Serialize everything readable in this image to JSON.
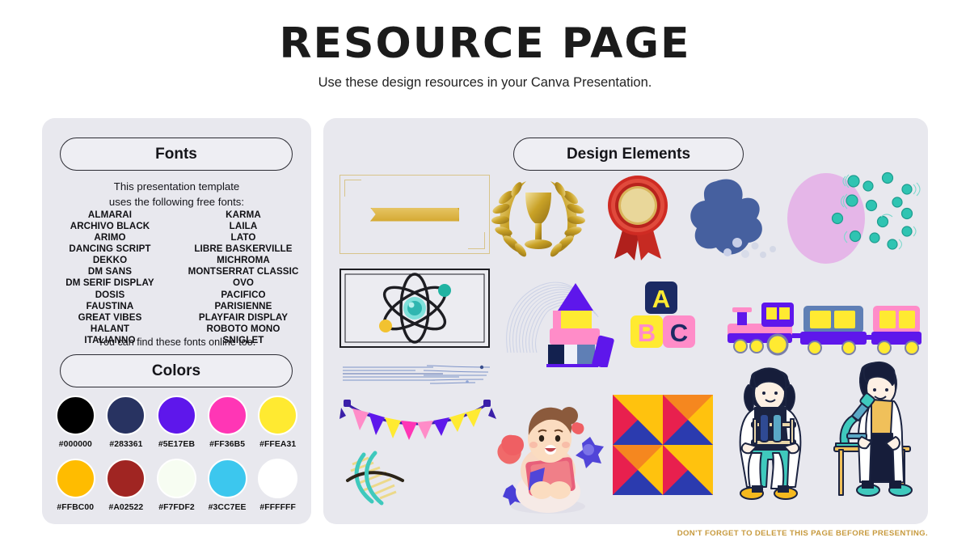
{
  "header": {
    "title": "RESOURCE PAGE",
    "subtitle": "Use these design resources in your Canva Presentation."
  },
  "fonts_panel": {
    "pill_label": "Fonts",
    "intro_line1": "This presentation template",
    "intro_line2": "uses the following free fonts:",
    "column_left": [
      "ALMARAI",
      "ARCHIVO BLACK",
      "ARIMO",
      "DANCING SCRIPT",
      "DEKKO",
      "DM SANS",
      "DM SERIF DISPLAY",
      "DOSIS",
      "FAUSTINA",
      "GREAT VIBES",
      "HALANT",
      "ITALIANNO"
    ],
    "column_right": [
      "KARMA",
      "LAILA",
      "LATO",
      "LIBRE BASKERVILLE",
      "MICHROMA",
      "MONTSERRAT CLASSIC",
      "OVO",
      "PACIFICO",
      "PARISIENNE",
      "PLAYFAIR DISPLAY",
      "ROBOTO MONO",
      "SNIGLET"
    ],
    "outro": "You can find these fonts online too."
  },
  "colors_panel": {
    "pill_label": "Colors",
    "swatches": [
      {
        "hex": "#000000",
        "label": "#000000"
      },
      {
        "hex": "#283361",
        "label": "#283361"
      },
      {
        "hex": "#5E17EB",
        "label": "#5E17EB"
      },
      {
        "hex": "#FF36B5",
        "label": "#FF36B5"
      },
      {
        "hex": "#FFEA31",
        "label": "#FFEA31"
      },
      {
        "hex": "#FFBC00",
        "label": "#FFBC00"
      },
      {
        "hex": "#A02522",
        "label": "#A02522"
      },
      {
        "hex": "#F7FDF2",
        "label": "#F7FDF2"
      },
      {
        "hex": "#3CC7EE",
        "label": "#3CC7EE"
      },
      {
        "hex": "#FFFFFF",
        "label": "#FFFFFF"
      }
    ]
  },
  "elements_panel": {
    "pill_label": "Design Elements",
    "items": [
      "certificate-frame-gold-ribbon",
      "laurel-wreath-trophy",
      "red-award-rosette",
      "blue-abstract-blob",
      "pink-oval-with-teal-microbes",
      "atom-in-frame",
      "blue-wave-lines",
      "toy-building-blocks",
      "abc-letter-blocks",
      "colorful-toy-train",
      "blue-line-decoration",
      "bunting-flags",
      "dna-helix",
      "girl-with-book-3d",
      "geometric-triangle-pattern",
      "scientist-with-test-tubes",
      "scientist-with-microscope"
    ]
  },
  "footer": {
    "note": "DON'T FORGET TO DELETE THIS PAGE BEFORE PRESENTING."
  },
  "palette": {
    "panel_bg": "#e8e8ee",
    "pill_bg": "#eeeef3",
    "pill_border": "#2b2b33",
    "footer_gold": "#c79a3e",
    "page_bg": "#ffffff"
  }
}
